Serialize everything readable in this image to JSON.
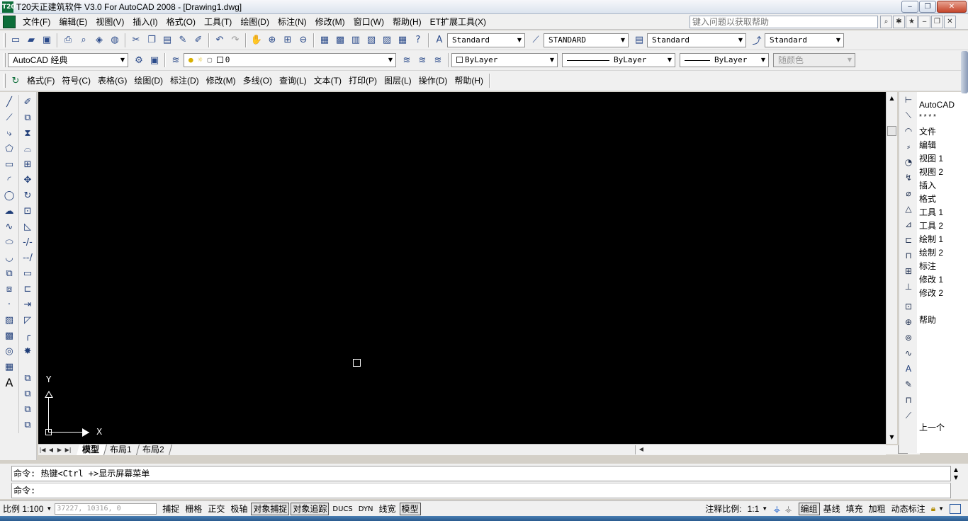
{
  "window": {
    "title": "T20天正建筑软件 V3.0 For AutoCAD 2008 - [Drawing1.dwg]",
    "logo": "T20",
    "controls": [
      "‒",
      "❐",
      "✕"
    ]
  },
  "menubar": {
    "items": [
      "文件(F)",
      "编辑(E)",
      "视图(V)",
      "插入(I)",
      "格式(O)",
      "工具(T)",
      "绘图(D)",
      "标注(N)",
      "修改(M)",
      "窗口(W)",
      "帮助(H)",
      "ET扩展工具(X)"
    ],
    "help_search_placeholder": "键入问题以获取帮助",
    "doc_controls": [
      "‒",
      "❐",
      "✕"
    ]
  },
  "toolbar1": {
    "text_style": "Standard",
    "dim_style": "STANDARD",
    "table_style": "Standard",
    "mleader_style": "Standard"
  },
  "toolbar2": {
    "workspace": "AutoCAD 经典",
    "layer": "0",
    "color": "ByLayer",
    "linetype": "ByLayer",
    "lineweight": "ByLayer",
    "plot_style": "随颜色"
  },
  "tianzheng_menu": {
    "items": [
      "格式(F)",
      "符号(C)",
      "表格(G)",
      "绘图(D)",
      "标注(D)",
      "修改(M)",
      "多线(O)",
      "查询(L)",
      "文本(T)",
      "打印(P)",
      "图层(L)",
      "操作(D)",
      "帮助(H)"
    ]
  },
  "canvas": {
    "ucs_y": "Y",
    "ucs_x": "X"
  },
  "layout_tabs": [
    "模型",
    "布局1",
    "布局2"
  ],
  "screen_menu": {
    "items": [
      "AutoCAD",
      "* * * *",
      "文件",
      "编辑",
      "视图 1",
      "视图 2",
      "插入",
      "格式",
      "工具 1",
      "工具 2",
      "绘制 1",
      "绘制 2",
      "标注",
      "修改 1",
      "修改 2"
    ],
    "help": "帮助",
    "prev": "上一个"
  },
  "command": {
    "history": "命令: 热键<Ctrl +>显示屏幕菜单",
    "prompt": "命令:"
  },
  "statusbar": {
    "scale_label": "比例 1:100",
    "coords": "37227, 10316, 0",
    "toggles": [
      {
        "label": "捕捉",
        "on": false
      },
      {
        "label": "栅格",
        "on": false
      },
      {
        "label": "正交",
        "on": false
      },
      {
        "label": "极轴",
        "on": false
      },
      {
        "label": "对象捕捉",
        "on": true
      },
      {
        "label": "对象追踪",
        "on": true
      },
      {
        "label": "DUCS",
        "on": false
      },
      {
        "label": "DYN",
        "on": false
      },
      {
        "label": "线宽",
        "on": false
      },
      {
        "label": "模型",
        "on": true
      }
    ],
    "annotation_scale_label": "注释比例:",
    "annotation_scale": "1:1",
    "right_toggles": [
      {
        "label": "编组",
        "on": true
      },
      {
        "label": "基线",
        "on": false
      },
      {
        "label": "填充",
        "on": false
      },
      {
        "label": "加粗",
        "on": false
      },
      {
        "label": "动态标注",
        "on": false
      }
    ]
  }
}
